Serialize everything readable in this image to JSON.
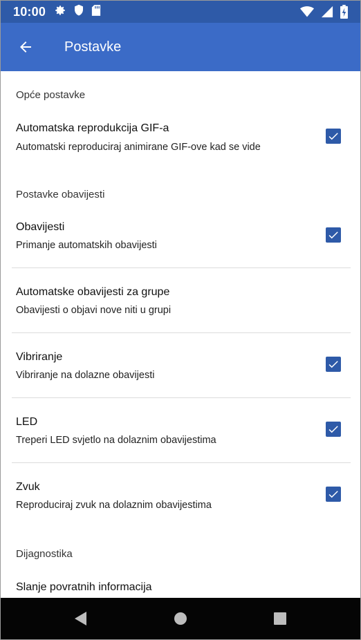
{
  "status": {
    "time": "10:00",
    "icons_left": [
      "gear-icon",
      "shield-icon",
      "sdcard-icon"
    ],
    "icons_right": [
      "wifi-icon",
      "signal-icon",
      "battery-icon"
    ]
  },
  "appbar": {
    "title": "Postavke",
    "back_icon": "arrow-left-icon",
    "bg": "#3b6bc7"
  },
  "sections": {
    "general": {
      "title": "Opće postavke",
      "items": [
        {
          "title": "Automatska reprodukcija GIF-a",
          "subtitle": "Automatski reproduciraj animirane GIF-ove kad se vide",
          "checked": true
        }
      ]
    },
    "notifications": {
      "title": "Postavke obavijesti",
      "items": [
        {
          "title": "Obavijesti",
          "subtitle": "Primanje automatskih obavijesti",
          "checked": true
        },
        {
          "title": "Automatske obavijesti za grupe",
          "subtitle": "Obavijesti o objavi nove niti u grupi",
          "checked": false
        },
        {
          "title": "Vibriranje",
          "subtitle": "Vibriranje na dolazne obavijesti",
          "checked": true
        },
        {
          "title": "LED",
          "subtitle": "Treperi LED svjetlo na dolaznim obavijestima",
          "checked": true
        },
        {
          "title": "Zvuk",
          "subtitle": "Reproduciraj zvuk na dolaznim obavijestima",
          "checked": true
        }
      ]
    },
    "diagnostics": {
      "title": "Dijagnostika",
      "items": [
        {
          "title": "Slanje povratnih informacija"
        }
      ]
    }
  },
  "colors": {
    "statusbar": "#2e5aa8",
    "checkbox": "#2e5aa8",
    "navbar": "#050505"
  }
}
